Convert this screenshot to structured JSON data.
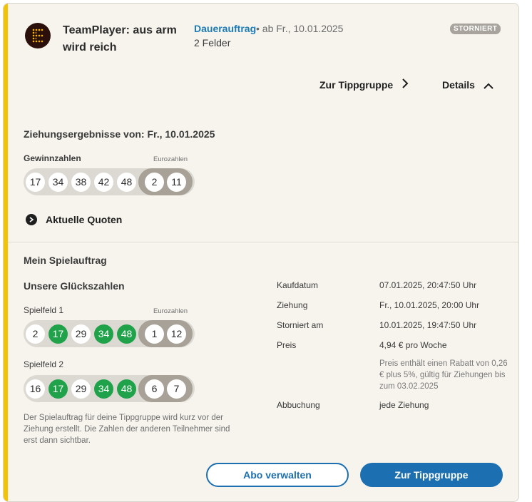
{
  "header": {
    "title": "TeamPlayer: aus arm wird reich",
    "order_type": "Dauerauftrag",
    "order_date": "• ab Fr., 10.01.2025",
    "fields": "2 Felder",
    "status": "STORNIERT"
  },
  "actions": {
    "group_link": "Zur Tippgruppe",
    "details": "Details"
  },
  "results": {
    "title": "Ziehungsergebnisse von: Fr., 10.01.2025",
    "numbers_label": "Gewinnzahlen",
    "euro_label": "Eurozahlen",
    "numbers": [
      "17",
      "34",
      "38",
      "42",
      "48"
    ],
    "euro": [
      "2",
      "11"
    ],
    "quotes_link": "Aktuelle Quoten"
  },
  "order": {
    "title": "Mein Spielauftrag",
    "lucky_title": "Unsere Glückszahlen",
    "euro_label": "Eurozahlen",
    "fields": [
      {
        "label": "Spielfeld 1",
        "numbers": [
          {
            "n": "2",
            "hit": false
          },
          {
            "n": "17",
            "hit": true
          },
          {
            "n": "29",
            "hit": false
          },
          {
            "n": "34",
            "hit": true
          },
          {
            "n": "48",
            "hit": true
          }
        ],
        "euro": [
          "1",
          "12"
        ]
      },
      {
        "label": "Spielfeld 2",
        "numbers": [
          {
            "n": "16",
            "hit": false
          },
          {
            "n": "17",
            "hit": true
          },
          {
            "n": "29",
            "hit": false
          },
          {
            "n": "34",
            "hit": true
          },
          {
            "n": "48",
            "hit": true
          }
        ],
        "euro": [
          "6",
          "7"
        ]
      }
    ],
    "info": [
      {
        "key": "Kaufdatum",
        "value": "07.01.2025, 20:47:50 Uhr"
      },
      {
        "key": "Ziehung",
        "value": "Fr., 10.01.2025, 20:00 Uhr"
      },
      {
        "key": "Storniert am",
        "value": "10.01.2025, 19:47:50 Uhr"
      },
      {
        "key": "Preis",
        "value": "4,94 € pro Woche"
      },
      {
        "key": "Abbuchung",
        "value": "jede Ziehung"
      }
    ],
    "price_note": "Preis enthält einen Rabatt von 0,26 € plus 5%, gültig für Ziehungen bis zum 03.02.2025",
    "note": "Der Spielauftrag für deine Tippgruppe wird kurz vor der Ziehung erstellt. Die Zahlen der anderen Teilnehmer sind erst dann sichtbar."
  },
  "buttons": {
    "manage": "Abo verwalten",
    "to_group": "Zur Tippgruppe"
  },
  "colors": {
    "accent_bar": "#f5c400",
    "link_blue": "#1c7bb5",
    "button_blue": "#1c6fb0",
    "hit_green": "#1fa24a",
    "badge_gray": "#a8a49d"
  }
}
